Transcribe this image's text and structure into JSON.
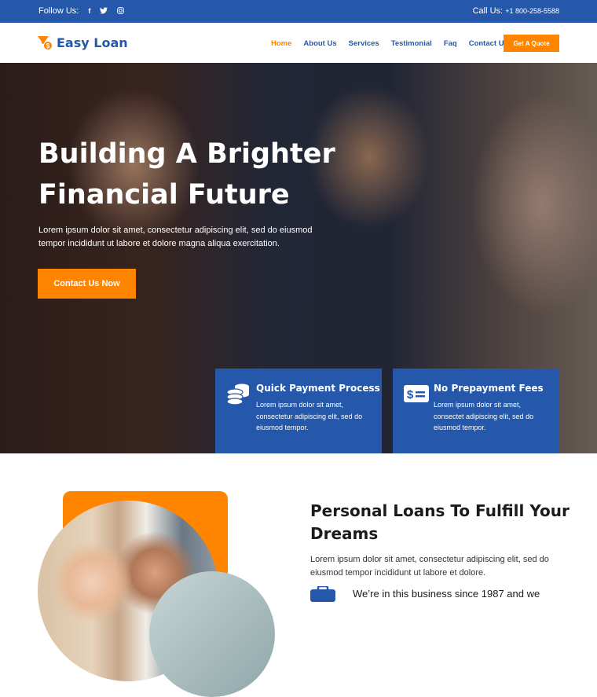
{
  "topbar": {
    "follow_label": "Follow Us:",
    "social": [
      {
        "icon": "facebook-icon",
        "glyph": "f"
      },
      {
        "icon": "twitter-icon",
        "glyph": "🐦"
      },
      {
        "icon": "instagram-icon",
        "glyph": "◎"
      }
    ],
    "call_label": "Call Us:",
    "phone": "+1 800-258-5588"
  },
  "nav": {
    "brand": "Easy Loan",
    "items": [
      {
        "label": "Home",
        "active": true
      },
      {
        "label": "About Us"
      },
      {
        "label": "Services"
      },
      {
        "label": "Testimonial"
      },
      {
        "label": "Faq"
      },
      {
        "label": "Contact Us"
      }
    ],
    "cta": "Get A Quote"
  },
  "hero": {
    "title": "Building A Brighter Financial Future",
    "description": "Lorem ipsum dolor sit amet, consectetur adipiscing elit, sed do eiusmod tempor incididunt ut labore et dolore magna aliqua exercitation.",
    "cta": "Contact Us Now",
    "features": [
      {
        "icon": "coins-icon",
        "title": "Quick Payment Process",
        "text": "Lorem ipsum dolor sit amet, consectetur adipiscing elit, sed do eiusmod tempor."
      },
      {
        "icon": "money-check-icon",
        "title": "No Prepayment Fees",
        "text": "Lorem ipsum dolor sit amet, consectet adipiscing elit, sed do eiusmod tempor."
      }
    ]
  },
  "about": {
    "title": "Personal Loans To Fulfill Your Dreams",
    "description": "Lorem ipsum dolor sit amet, consectetur adipiscing elit, sed do eiusmod tempor incididunt ut labore et dolore.",
    "experience": "We’re in this business since 1987 and we"
  },
  "colors": {
    "primary": "#2558ab",
    "accent": "#ff8400"
  }
}
